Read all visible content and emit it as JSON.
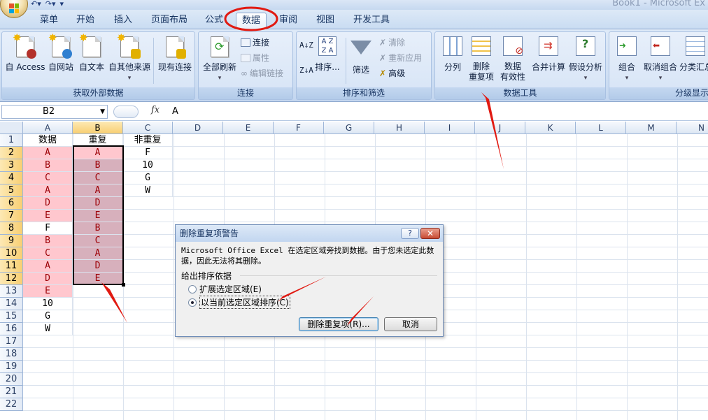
{
  "window": {
    "title": "Book1 - Microsoft Ex"
  },
  "ribbon_tabs": [
    "菜单",
    "开始",
    "插入",
    "页面布局",
    "公式",
    "数据",
    "审阅",
    "视图",
    "开发工具"
  ],
  "active_tab": "数据",
  "groups": {
    "external": {
      "label": "获取外部数据",
      "buttons": [
        "自 Access",
        "自网站",
        "自文本",
        "自其他来源",
        "现有连接"
      ]
    },
    "connections": {
      "label": "连接",
      "refresh": "全部刷新",
      "items": [
        "连接",
        "属性",
        "编辑链接"
      ]
    },
    "sort_filter": {
      "label": "排序和筛选",
      "sort_az": "A↓Z",
      "sort_za": "Z↓A",
      "sort": "排序...",
      "filter": "筛选",
      "items": [
        "清除",
        "重新应用",
        "高级"
      ]
    },
    "data_tools": {
      "label": "数据工具",
      "buttons": [
        "分列",
        "删除\n重复项",
        "数据\n有效性",
        "合并计算",
        "假设分析"
      ]
    },
    "outline": {
      "label": "分级显示",
      "buttons": [
        "组合",
        "取消组合",
        "分类汇总"
      ]
    }
  },
  "formula_bar": {
    "name_box": "B2",
    "fx": "fx",
    "formula": "A"
  },
  "columns": [
    "A",
    "B",
    "C",
    "D",
    "E",
    "F",
    "G",
    "H",
    "I",
    "J",
    "K",
    "L",
    "M",
    "N"
  ],
  "rows": [
    "1",
    "2",
    "3",
    "4",
    "5",
    "6",
    "7",
    "8",
    "9",
    "10",
    "11",
    "12",
    "13",
    "14",
    "15",
    "16",
    "17",
    "18",
    "19",
    "20",
    "21",
    "22"
  ],
  "sheet": {
    "A": [
      "数据",
      "A",
      "B",
      "C",
      "A",
      "D",
      "E",
      "F",
      "B",
      "C",
      "A",
      "D",
      "E",
      "10",
      "G",
      "W"
    ],
    "B": [
      "重复",
      "A",
      "B",
      "C",
      "A",
      "D",
      "E",
      "B",
      "C",
      "A",
      "D",
      "E"
    ],
    "C": [
      "非重复",
      "F",
      "10",
      "G",
      "W"
    ]
  },
  "dialog": {
    "title": "删除重复项警告",
    "help": "?",
    "message": "Microsoft Office Excel 在选定区域旁找到数据。由于您未选定此数据，因此无法将其删除。",
    "section": "给出排序依据",
    "option1": "扩展选定区域(E)",
    "option2": "以当前选定区域排序(C)",
    "btn_remove": "删除重复项(R)...",
    "btn_cancel": "取消"
  },
  "colors": {
    "accent_red": "#e11a12",
    "dup_fill": "#ffc7ce",
    "dup_text": "#9c0006"
  }
}
